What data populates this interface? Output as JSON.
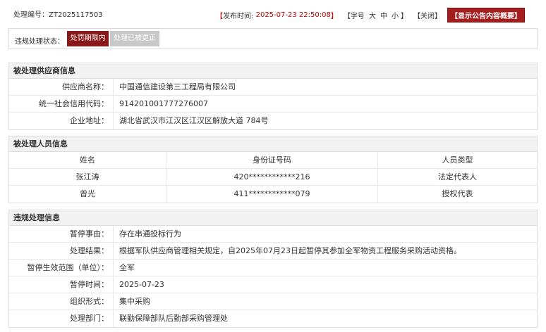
{
  "header": {
    "case_no_label": "处理编号：",
    "case_no": "ZT2025117503",
    "publish_label": "发布时间:",
    "publish_time": "2025-07-23 22:50:08",
    "font_label": "字号",
    "font_large": "大",
    "font_medium": "中",
    "font_small": "小",
    "close_label": "关闭",
    "show_summary": "显示公告内容概要"
  },
  "status": {
    "label": "违规处理状态：",
    "active": "处罚期限内",
    "inactive": "处理已被更正"
  },
  "supplier": {
    "title": "被处理供应商信息",
    "rows": [
      {
        "label": "供应商名称：",
        "value": "中国通信建设第三工程局有限公司"
      },
      {
        "label": "统一社会信用代码：",
        "value": "914201001777276007"
      },
      {
        "label": "企业地址：",
        "value": "湖北省武汉市江汉区江汉区解放大道 784号"
      }
    ]
  },
  "personnel": {
    "title": "被处理人员信息",
    "columns": [
      "姓名",
      "身份证号码",
      "人员类型"
    ],
    "rows": [
      [
        "张江涛",
        "420************216",
        "法定代表人"
      ],
      [
        "曾光",
        "411************079",
        "授权代表"
      ]
    ]
  },
  "violation": {
    "title": "违规处理信息",
    "rows": [
      {
        "label": "暂停事由：",
        "value": "存在串通投标行为"
      },
      {
        "label": "处理结果：",
        "value": "根据军队供应商管理相关规定，自2025年07月23日起暂停其参加全军物资工程服务采购活动资格。"
      },
      {
        "label": "暂停生效范围（单位）：",
        "value": "全军"
      },
      {
        "label": "暂停时间：",
        "value": "2025-07-23"
      },
      {
        "label": "组织形式：",
        "value": "集中采购"
      },
      {
        "label": "处理部门：",
        "value": "联勤保障部队后勤部采购管理处"
      }
    ]
  },
  "colors": {
    "accent_red": "#8b1818",
    "time_red": "#c00000",
    "header_bg": "#f2f2f2"
  }
}
